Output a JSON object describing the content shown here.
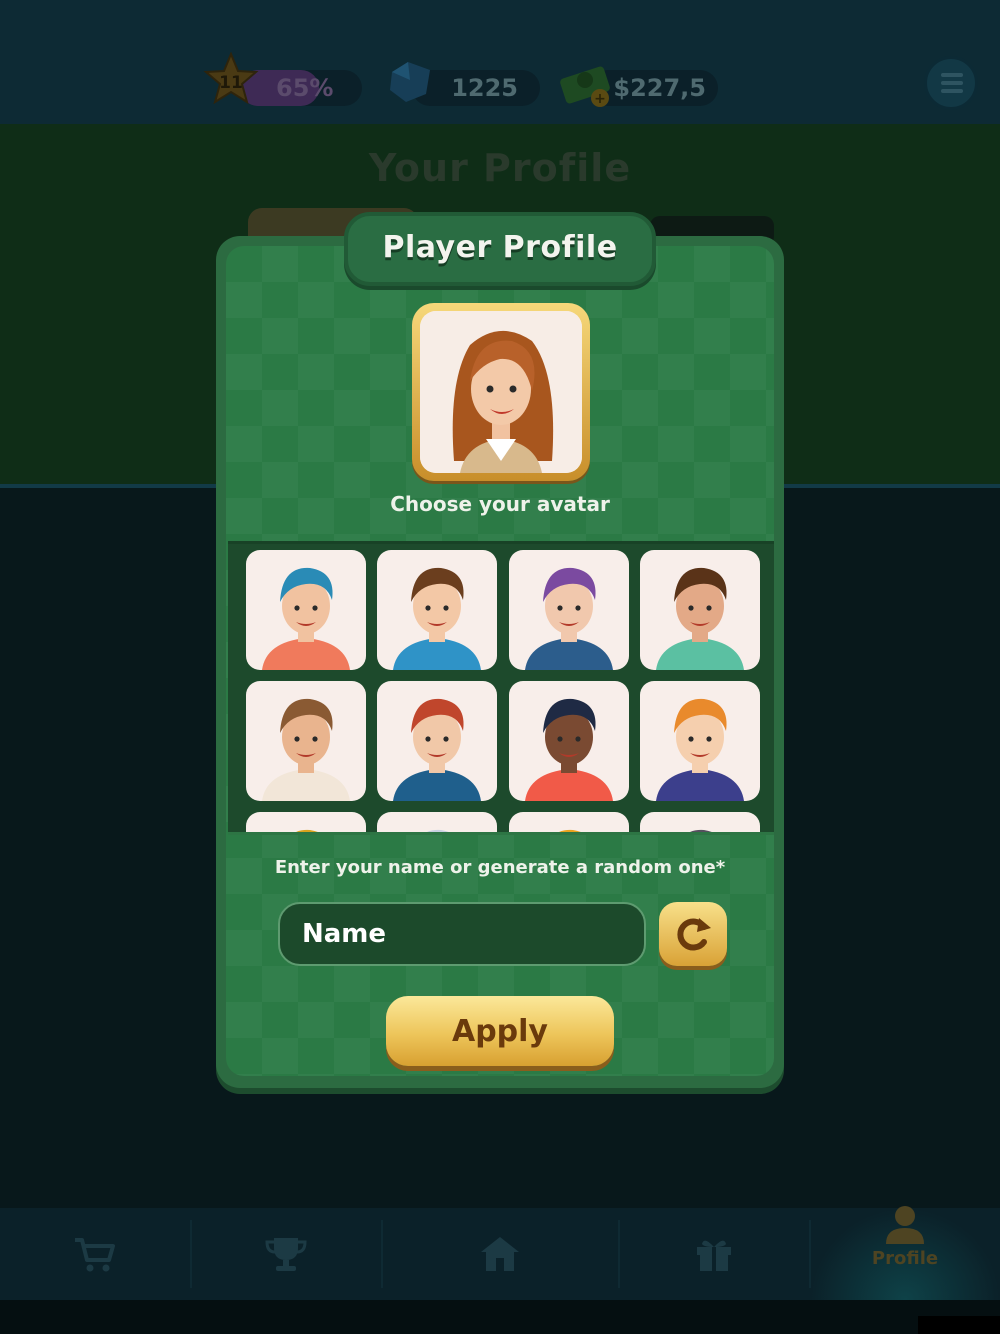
{
  "hud": {
    "level": "11",
    "level_progress_label": "65%",
    "level_progress": 0.65,
    "gems": "1225",
    "cash": "$227,5"
  },
  "background": {
    "page_title": "Your Profile"
  },
  "modal": {
    "title": "Player Profile",
    "choose_label": "Choose your avatar",
    "name_prompt": "Enter your name or generate a random one*",
    "name_placeholder": "Name",
    "apply_label": "Apply"
  },
  "avatars": [
    {
      "hair": "#2a8bb6",
      "skin": "#f1c2a0",
      "shirt": "#f07a5c"
    },
    {
      "hair": "#6b3e1e",
      "skin": "#f3c8a6",
      "shirt": "#2f93c7"
    },
    {
      "hair": "#7b4aa0",
      "skin": "#f1c8ad",
      "shirt": "#2c5d8c"
    },
    {
      "hair": "#5a3318",
      "skin": "#e3a987",
      "shirt": "#5bc0a2"
    },
    {
      "hair": "#8a5a33",
      "skin": "#e9b48e",
      "shirt": "#f2e6d8"
    },
    {
      "hair": "#c0462c",
      "skin": "#f1c8a8",
      "shirt": "#1f5f8c"
    },
    {
      "hair": "#1f2a44",
      "skin": "#7a4a32",
      "shirt": "#f15a48"
    },
    {
      "hair": "#e98a2c",
      "skin": "#f5cfae",
      "shirt": "#3c3f8c"
    },
    {
      "hair": "#d9a21e",
      "skin": "#f1c8a8",
      "shirt": "#f07a5c"
    },
    {
      "hair": "#c8d0e0",
      "skin": "#f1c8a8",
      "shirt": "#2f93c7"
    },
    {
      "hair": "#e9a21e",
      "skin": "#f1c8a8",
      "shirt": "#2c5d8c"
    },
    {
      "hair": "#55505e",
      "skin": "#f1c8a8",
      "shirt": "#5bc0a2"
    }
  ],
  "nav": {
    "items": [
      {
        "icon": "cart-icon"
      },
      {
        "icon": "trophy-icon"
      },
      {
        "icon": "home-icon"
      },
      {
        "icon": "gift-icon"
      },
      {
        "icon": "profile-icon",
        "label": "Profile"
      }
    ]
  },
  "colors": {
    "modal_green": "#2b7a45",
    "gold_button": "#edc55a"
  }
}
